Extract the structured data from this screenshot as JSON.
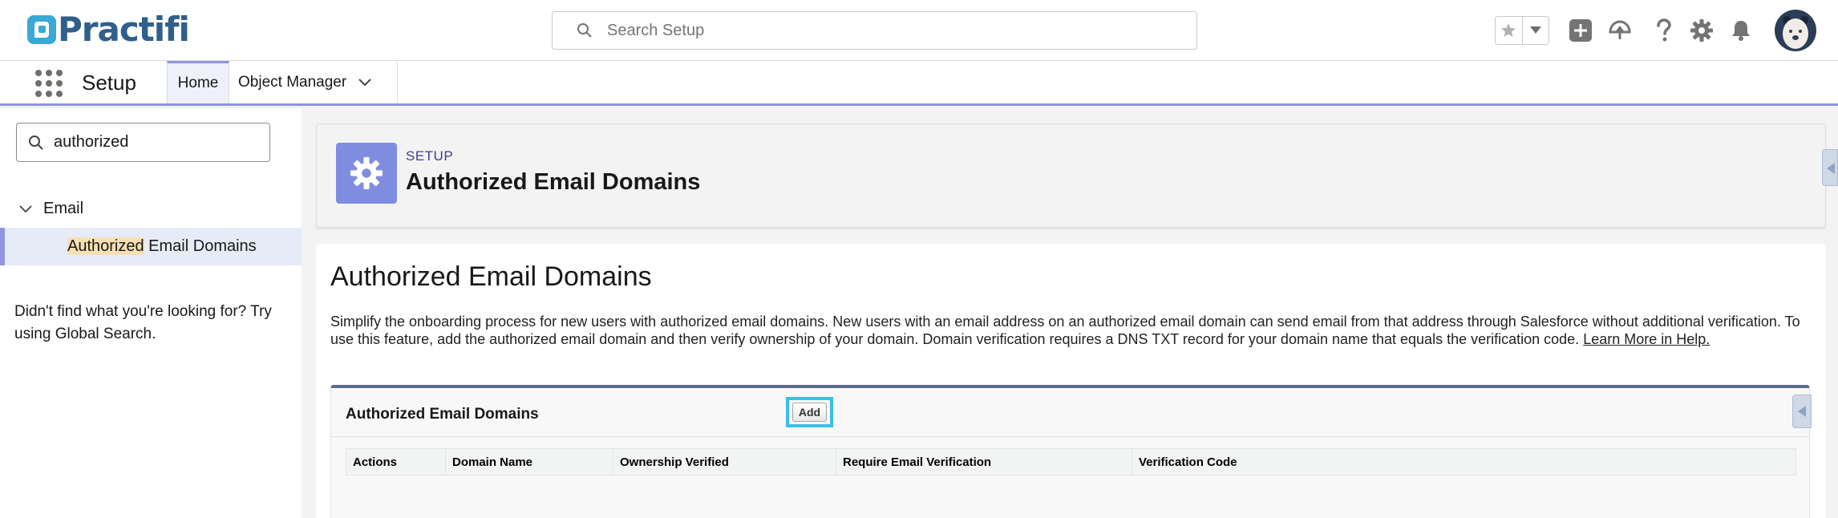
{
  "header": {
    "logo_text": "Practifi",
    "search_placeholder": "Search Setup"
  },
  "nav": {
    "app_name": "Setup",
    "tabs": [
      {
        "label": "Home",
        "active": true
      },
      {
        "label": "Object Manager",
        "active": false
      }
    ]
  },
  "sidebar": {
    "quick_find_value": "authorized",
    "tree": {
      "parent_label": "Email",
      "child_highlight": "Authorized",
      "child_rest": " Email Domains"
    },
    "not_found": "Didn't find what you're looking for? Try using Global Search."
  },
  "page_header": {
    "eyebrow": "SETUP",
    "title": "Authorized Email Domains"
  },
  "content": {
    "title": "Authorized Email Domains",
    "description": "Simplify the onboarding process for new users with authorized email domains. New users with an email address on an authorized email domain can send email from that address through Salesforce without additional verification. To use this feature, add the authorized email domain and then verify ownership of your domain. Domain verification requires a DNS TXT record for your domain name that equals the verification code.",
    "help_link": "Learn More in Help."
  },
  "related_list": {
    "title": "Authorized Email Domains",
    "add_label": "Add",
    "columns": [
      "Actions",
      "Domain Name",
      "Ownership Verified",
      "Require Email Verification",
      "Verification Code"
    ]
  },
  "colors": {
    "accent": "#8f95e0",
    "setup_icon_bg": "#7f8de1",
    "highlight": "#f8dfb3",
    "focus_outline": "#3bbfe8"
  }
}
